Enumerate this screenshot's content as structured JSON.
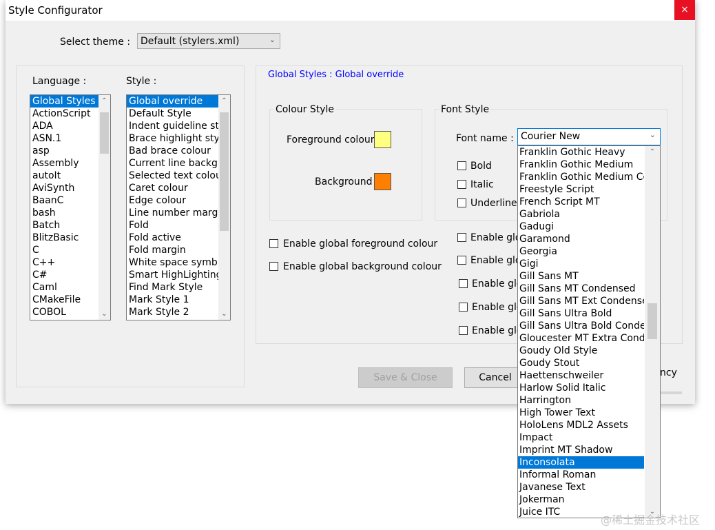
{
  "window": {
    "title": "Style Configurator",
    "close_glyph": "×"
  },
  "theme": {
    "label": "Select theme :",
    "value": "Default (stylers.xml)"
  },
  "language": {
    "label": "Language :",
    "items": [
      "Global Styles",
      "ActionScript",
      "ADA",
      "ASN.1",
      "asp",
      "Assembly",
      "autoIt",
      "AviSynth",
      "BaanC",
      "bash",
      "Batch",
      "BlitzBasic",
      "C",
      "C++",
      "C#",
      "Caml",
      "CMakeFile",
      "COBOL"
    ]
  },
  "style": {
    "label": "Style :",
    "items": [
      "Global override",
      "Default Style",
      "Indent guideline sty",
      "Brace highlight style",
      "Bad brace colour",
      "Current line backgr",
      "Selected text colou",
      "Caret colour",
      "Edge colour",
      "Line number margi",
      "Fold",
      "Fold active",
      "Fold margin",
      "White space symb",
      "Smart HighLighting",
      "Find Mark Style",
      "Mark Style 1",
      "Mark Style 2"
    ]
  },
  "section_title": "Global Styles : Global override",
  "colour_style": {
    "title": "Colour Style",
    "fg_label": "Foreground colour",
    "bg_label": "Background",
    "fg_color": "#ffff80",
    "bg_color": "#ff8000"
  },
  "font_style": {
    "title": "Font Style",
    "font_name_label": "Font name :",
    "font_name_value": "Courier New",
    "bold": "Bold",
    "italic": "Italic",
    "underline": "Underline"
  },
  "global_options": {
    "enable_fg": "Enable global foreground colour",
    "enable_bg": "Enable global background colour",
    "right_items": [
      "Enable glob",
      "Enable glob",
      "Enable glo",
      "Enable glo",
      "Enable glo"
    ]
  },
  "buttons": {
    "save_close": "Save & Close",
    "cancel": "Cancel",
    "transparency_fragment": "ncy"
  },
  "font_dropdown": {
    "items": [
      "Franklin Gothic Heavy",
      "Franklin Gothic Medium",
      "Franklin Gothic Medium Con",
      "Freestyle Script",
      "French Script MT",
      "Gabriola",
      "Gadugi",
      "Garamond",
      "Georgia",
      "Gigi",
      "Gill Sans MT",
      "Gill Sans MT Condensed",
      "Gill Sans MT Ext Condensed",
      "Gill Sans Ultra Bold",
      "Gill Sans Ultra Bold Condens",
      "Gloucester MT Extra Conde",
      "Goudy Old Style",
      "Goudy Stout",
      "Haettenschweiler",
      "Harlow Solid Italic",
      "Harrington",
      "High Tower Text",
      "HoloLens MDL2 Assets",
      "Impact",
      "Imprint MT Shadow",
      "Inconsolata",
      "Informal Roman",
      "Javanese Text",
      "Jokerman",
      "Juice ITC"
    ],
    "selected": "Inconsolata"
  },
  "watermark": "@稀土掘金技术社区",
  "icons": {
    "scroll_up": "▲",
    "scroll_down": "▼",
    "combo_arrow": "⌵"
  }
}
